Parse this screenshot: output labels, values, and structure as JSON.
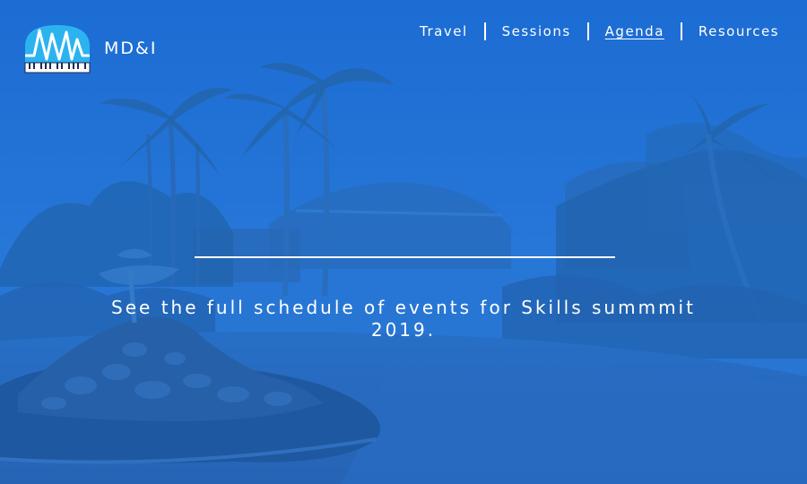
{
  "brand": {
    "name": "MD&I",
    "logo_icon": "piano-waveform-logo-icon"
  },
  "nav": {
    "items": [
      {
        "label": "Travel",
        "active": false
      },
      {
        "label": "Sessions",
        "active": false
      },
      {
        "label": "Agenda",
        "active": true
      },
      {
        "label": "Resources",
        "active": false
      }
    ]
  },
  "hero": {
    "tagline": "See the full schedule of events for Skills summmit 2019.",
    "background": "tropical-resort-photo"
  },
  "colors": {
    "overlay_blue": "#1e6fd0",
    "text": "#ffffff",
    "logo_blue": "#2bb3f0"
  }
}
